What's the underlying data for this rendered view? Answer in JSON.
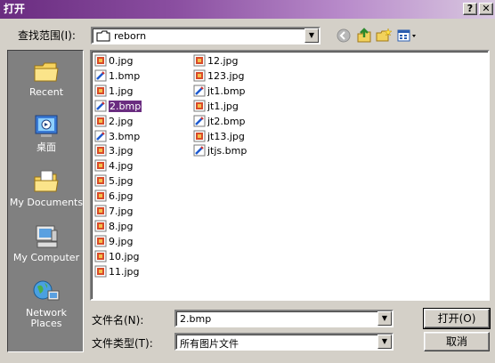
{
  "window": {
    "title": "打开",
    "help_label": "?",
    "close_label": "✕"
  },
  "lookin": {
    "label": "查找范围(I):",
    "value": "reborn"
  },
  "places": [
    {
      "label": "Recent",
      "icon": "recent-folder-icon"
    },
    {
      "label": "桌面",
      "icon": "desktop-icon"
    },
    {
      "label": "My Documents",
      "icon": "my-documents-icon"
    },
    {
      "label": "My Computer",
      "icon": "my-computer-icon"
    },
    {
      "label": "Network Places",
      "icon": "network-places-icon"
    }
  ],
  "files": [
    {
      "name": "0.jpg",
      "type": "jpg"
    },
    {
      "name": "1.bmp",
      "type": "bmp"
    },
    {
      "name": "1.jpg",
      "type": "jpg"
    },
    {
      "name": "2.bmp",
      "type": "bmp",
      "selected": true
    },
    {
      "name": "2.jpg",
      "type": "jpg"
    },
    {
      "name": "3.bmp",
      "type": "bmp"
    },
    {
      "name": "3.jpg",
      "type": "jpg"
    },
    {
      "name": "4.jpg",
      "type": "jpg"
    },
    {
      "name": "5.jpg",
      "type": "jpg"
    },
    {
      "name": "6.jpg",
      "type": "jpg"
    },
    {
      "name": "7.jpg",
      "type": "jpg"
    },
    {
      "name": "8.jpg",
      "type": "jpg"
    },
    {
      "name": "9.jpg",
      "type": "jpg"
    },
    {
      "name": "10.jpg",
      "type": "jpg"
    },
    {
      "name": "11.jpg",
      "type": "jpg"
    },
    {
      "name": "12.jpg",
      "type": "jpg"
    },
    {
      "name": "123.jpg",
      "type": "jpg"
    },
    {
      "name": "jt1.bmp",
      "type": "bmp"
    },
    {
      "name": "jt1.jpg",
      "type": "jpg"
    },
    {
      "name": "jt2.bmp",
      "type": "bmp"
    },
    {
      "name": "jt13.jpg",
      "type": "jpg"
    },
    {
      "name": "jtjs.bmp",
      "type": "bmp"
    }
  ],
  "filename": {
    "label": "文件名(N):",
    "value": "2.bmp"
  },
  "filetype": {
    "label": "文件类型(T):",
    "value": "所有图片文件"
  },
  "buttons": {
    "open": "打开(O)",
    "cancel": "取消"
  },
  "colors": {
    "selection": "#6a2c80",
    "title_start": "#6a2c80"
  }
}
